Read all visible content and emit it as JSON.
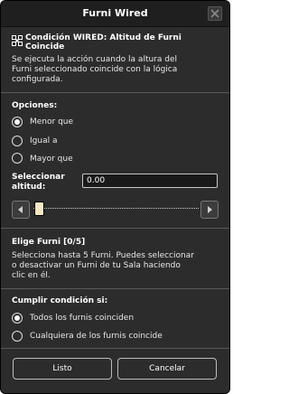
{
  "window": {
    "title": "Furni Wired"
  },
  "header": {
    "title_line1": "Condición WIRED: Altitud de Furni",
    "title_line2": "Coincide",
    "description_line1": "Se ejecuta la acción cuando la altura del",
    "description_line2": "Furni seleccionado coincide con la lógica",
    "description_line3": "configurada."
  },
  "options": {
    "label": "Opciones:",
    "items": [
      {
        "label": "Menor que",
        "selected": true
      },
      {
        "label": "Igual a",
        "selected": false
      },
      {
        "label": "Mayor que",
        "selected": false
      }
    ]
  },
  "altitude": {
    "label_line1": "Seleccionar",
    "label_line2": "altitud:",
    "value": "0.00",
    "slider_value": 0
  },
  "furni_select": {
    "title": "Elige Furni [0/5]",
    "description_line1": "Selecciona hasta 5 Furni. Puedes seleccionar",
    "description_line2": "o desactivar un Furni de tu Sala haciendo",
    "description_line3": "clic en él."
  },
  "condition": {
    "label": "Cumplir condición si:",
    "items": [
      {
        "label": "Todos los furnis coinciden",
        "selected": true
      },
      {
        "label": "Cualquiera de los furnis coincide",
        "selected": false
      }
    ]
  },
  "buttons": {
    "ok": "Listo",
    "cancel": "Cancelar"
  },
  "colors": {
    "background": "#2c2c2c",
    "titlebar": "#1f1f1f",
    "text": "#e8e8e8"
  }
}
